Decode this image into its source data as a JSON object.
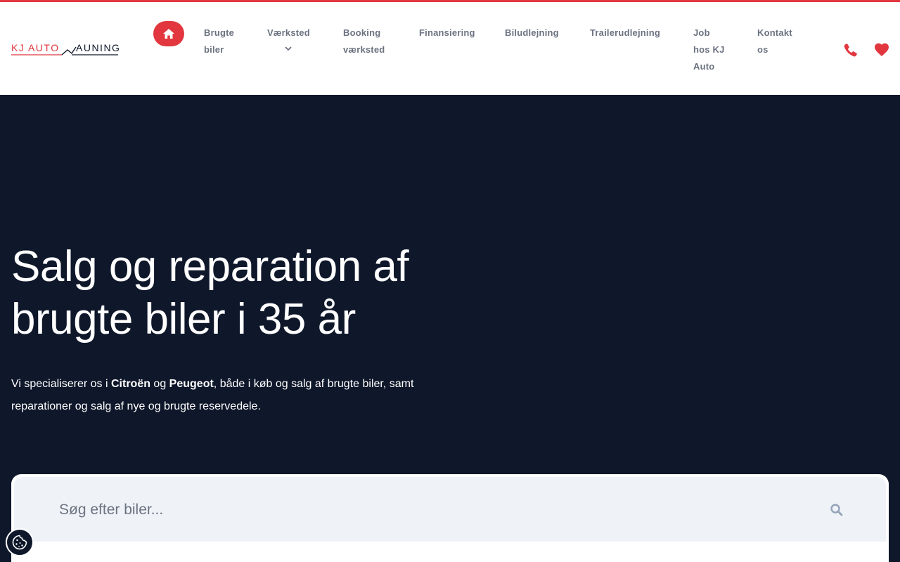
{
  "brand": {
    "logo_part1": "KJ AUTO",
    "logo_part2": "AUNING",
    "accent_color": "#e2373f",
    "dark_color": "#0f172a"
  },
  "nav": {
    "home_icon": "home-icon",
    "items": [
      {
        "line1": "Brugte",
        "line2": "biler",
        "line3": ""
      },
      {
        "line1": "Værksted",
        "line2": "",
        "line3": "",
        "has_dropdown": true
      },
      {
        "line1": "Booking",
        "line2": "værksted",
        "line3": ""
      },
      {
        "line1": "Finansiering",
        "line2": "",
        "line3": ""
      },
      {
        "line1": "Biludlejning",
        "line2": "",
        "line3": ""
      },
      {
        "line1": "Trailerudlejning",
        "line2": "",
        "line3": ""
      },
      {
        "line1": "Job",
        "line2": "hos KJ",
        "line3": "Auto"
      },
      {
        "line1": "Kontakt",
        "line2": "os",
        "line3": ""
      }
    ],
    "phone_icon": "phone-icon",
    "favorites_icon": "heart-icon"
  },
  "hero": {
    "title_line1": "Salg og reparation af",
    "title_line2": "brugte biler i 35 år",
    "text_pre": "Vi specialiserer os i ",
    "brand1": "Citroën",
    "text_mid": " og ",
    "brand2": "Peugeot",
    "text_post": ", både i køb og salg af brugte biler, samt reparationer og salg af nye og brugte reservedele."
  },
  "search": {
    "placeholder": "Søg efter biler...",
    "value": "",
    "icon": "search-icon"
  },
  "cookie": {
    "icon": "cookie-icon"
  }
}
